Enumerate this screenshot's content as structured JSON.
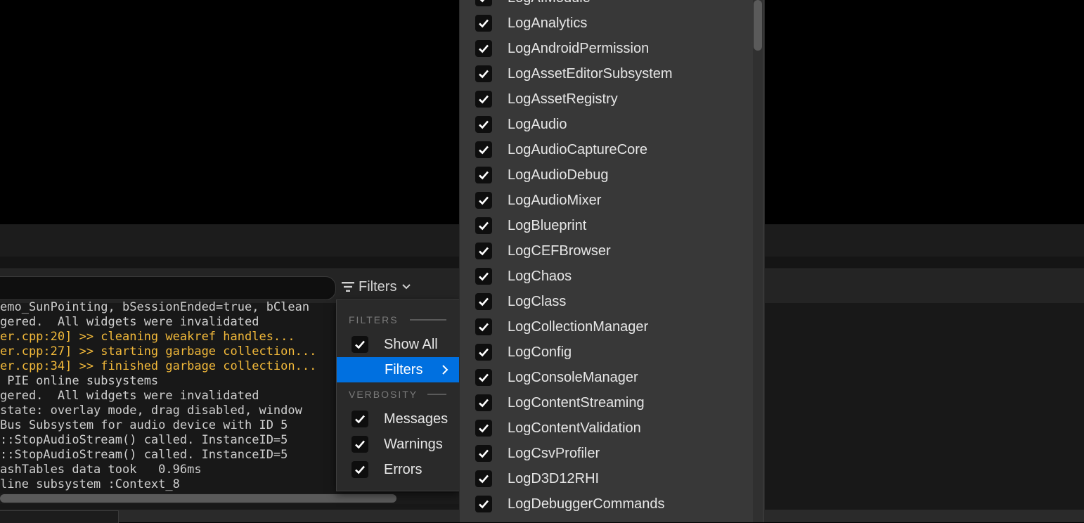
{
  "toolbar": {
    "search_placeholder": "",
    "filters_label": "Filters"
  },
  "log_lines": [
    {
      "text": "emo_SunPointing, bSessionEnded=true, bClean",
      "level": "normal"
    },
    {
      "text": "gered.  All widgets were invalidated",
      "level": "normal"
    },
    {
      "text": "er.cpp:20] >> cleaning weakref handles...",
      "level": "warning"
    },
    {
      "text": "er.cpp:27] >> starting garbage collection...",
      "level": "warning"
    },
    {
      "text": "er.cpp:34] >> finished garbage collection...",
      "level": "warning"
    },
    {
      "text": " PIE online subsystems",
      "level": "normal"
    },
    {
      "text": "gered.  All widgets were invalidated",
      "level": "normal"
    },
    {
      "text": "state: overlay mode, drag disabled, window",
      "level": "normal"
    },
    {
      "text": "Bus Subsystem for audio device with ID 5",
      "level": "normal"
    },
    {
      "text": "::StopAudioStream() called. InstanceID=5",
      "level": "normal"
    },
    {
      "text": "::StopAudioStream() called. InstanceID=5",
      "level": "normal"
    },
    {
      "text": "ashTables data took   0.96ms",
      "level": "normal"
    },
    {
      "text": "line subsystem :Context_8",
      "level": "normal"
    }
  ],
  "filter_menu": {
    "filters_header": "FILTERS",
    "show_all": {
      "label": "Show All",
      "checked": true
    },
    "filters_submenu": {
      "label": "Filters"
    },
    "verbosity_header": "VERBOSITY",
    "verbosity": [
      {
        "label": "Messages",
        "checked": true
      },
      {
        "label": "Warnings",
        "checked": true
      },
      {
        "label": "Errors",
        "checked": true
      }
    ]
  },
  "categories": [
    {
      "label": "LogAIModule",
      "checked": true
    },
    {
      "label": "LogAnalytics",
      "checked": true
    },
    {
      "label": "LogAndroidPermission",
      "checked": true
    },
    {
      "label": "LogAssetEditorSubsystem",
      "checked": true
    },
    {
      "label": "LogAssetRegistry",
      "checked": true
    },
    {
      "label": "LogAudio",
      "checked": true
    },
    {
      "label": "LogAudioCaptureCore",
      "checked": true
    },
    {
      "label": "LogAudioDebug",
      "checked": true
    },
    {
      "label": "LogAudioMixer",
      "checked": true
    },
    {
      "label": "LogBlueprint",
      "checked": true
    },
    {
      "label": "LogCEFBrowser",
      "checked": true
    },
    {
      "label": "LogChaos",
      "checked": true
    },
    {
      "label": "LogClass",
      "checked": true
    },
    {
      "label": "LogCollectionManager",
      "checked": true
    },
    {
      "label": "LogConfig",
      "checked": true
    },
    {
      "label": "LogConsoleManager",
      "checked": true
    },
    {
      "label": "LogContentStreaming",
      "checked": true
    },
    {
      "label": "LogContentValidation",
      "checked": true
    },
    {
      "label": "LogCsvProfiler",
      "checked": true
    },
    {
      "label": "LogD3D12RHI",
      "checked": true
    },
    {
      "label": "LogDebuggerCommands",
      "checked": true
    }
  ],
  "colors": {
    "accent": "#0070e0",
    "warning_text": "#f2b93a"
  }
}
